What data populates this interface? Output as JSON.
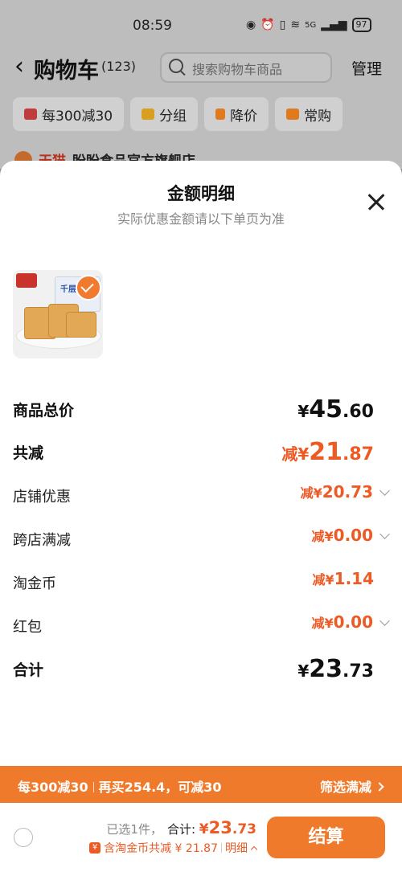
{
  "status_bar": {
    "time": "08:59",
    "network": "5G",
    "battery": "97"
  },
  "header": {
    "title": "购物车",
    "count": "(123)",
    "search_placeholder": "搜索购物车商品",
    "manage": "管理"
  },
  "filters": [
    {
      "label": "每300减30",
      "icon": "shop-promo-icon",
      "color": "#c03b3b"
    },
    {
      "label": "分组",
      "icon": "folder-icon",
      "color": "#d9a020"
    },
    {
      "label": "降价",
      "icon": "arrow-down-icon",
      "color": "#e07a1e"
    },
    {
      "label": "常购",
      "icon": "cart-icon",
      "color": "#e07a1e"
    }
  ],
  "shop_name": {
    "prefix": "天猫",
    "name": "盼盼食品官方旗舰店"
  },
  "sheet": {
    "title": "金额明细",
    "subtitle": "实际优惠金额请以下单页为准",
    "product_image": "product-biscuit-thumbnail",
    "rows": {
      "total": {
        "label": "商品总价",
        "prefix": "",
        "currency": "¥",
        "int": "45",
        "dec": ".60"
      },
      "discount": {
        "label": "共减",
        "prefix": "减",
        "currency": "¥",
        "int": "21",
        "dec": ".87"
      },
      "shop_coupon": {
        "label": "店铺优惠",
        "prefix": "减",
        "currency": "¥",
        "int": "20",
        "dec": ".73"
      },
      "cross_store": {
        "label": "跨店满减",
        "prefix": "减",
        "currency": "¥",
        "int": "0",
        "dec": ".00"
      },
      "tao_coin": {
        "label": "淘金币",
        "prefix": "减",
        "currency": "¥",
        "int": "1",
        "dec": ".14"
      },
      "red_packet": {
        "label": "红包",
        "prefix": "减",
        "currency": "¥",
        "int": "0",
        "dec": ".00"
      },
      "grand_total": {
        "label": "合计",
        "prefix": "",
        "currency": "¥",
        "int": "23",
        "dec": ".73"
      }
    }
  },
  "promo_bar": {
    "left": "每300减30",
    "middle": "再买254.4，可减30",
    "right": "筛选满减"
  },
  "bottom_bar": {
    "selected": "已选1件，",
    "total_label": "合计: ",
    "total_currency": "¥",
    "total_int": "23",
    "total_dec": ".73",
    "coin_note": "含淘金币共减 ¥ 21.87",
    "detail": "明细",
    "checkout": "结算"
  },
  "colors": {
    "accent": "#f07a2c",
    "discount_text": "#ee5a24"
  }
}
